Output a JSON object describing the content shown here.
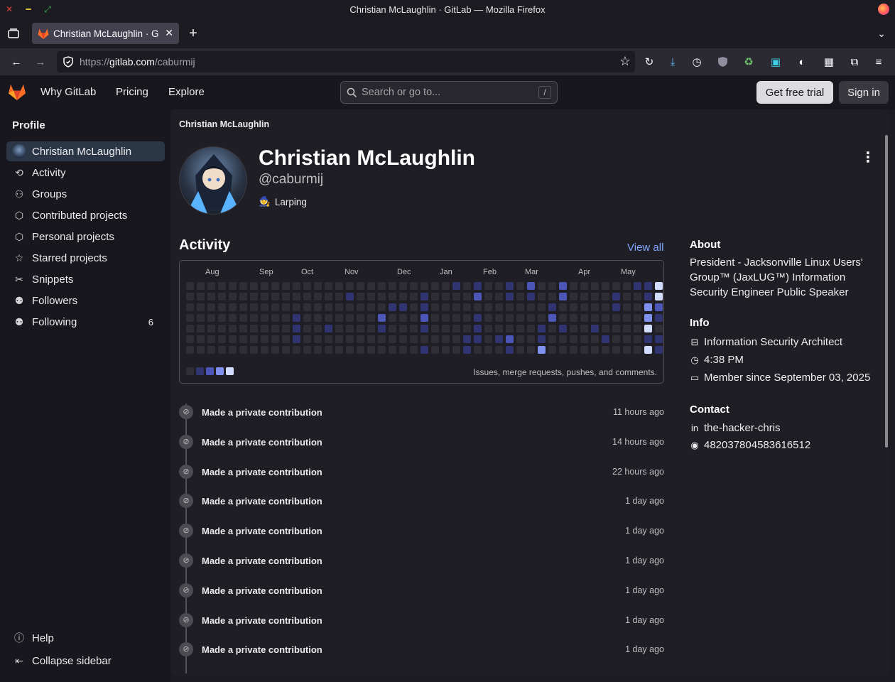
{
  "window": {
    "title": "Christian McLaughlin · GitLab — Mozilla Firefox"
  },
  "tab": {
    "title": "Christian McLaughlin · G"
  },
  "url": {
    "scheme": "https://",
    "host": "gitlab.com",
    "path": "/caburmij"
  },
  "header": {
    "nav": [
      "Why GitLab",
      "Pricing",
      "Explore"
    ],
    "search_placeholder": "Search or go to...",
    "search_shortcut": "/",
    "trial_label": "Get free trial",
    "signin_label": "Sign in"
  },
  "sidebar": {
    "section": "Profile",
    "items": [
      {
        "label": "Christian McLaughlin",
        "icon": "avatar"
      },
      {
        "label": "Activity",
        "icon": "history-icon"
      },
      {
        "label": "Groups",
        "icon": "group-icon"
      },
      {
        "label": "Contributed projects",
        "icon": "project-icon"
      },
      {
        "label": "Personal projects",
        "icon": "project-icon"
      },
      {
        "label": "Starred projects",
        "icon": "star-icon"
      },
      {
        "label": "Snippets",
        "icon": "snippet-icon"
      },
      {
        "label": "Followers",
        "icon": "users-icon"
      },
      {
        "label": "Following",
        "icon": "users-icon",
        "count": "6"
      }
    ],
    "help_label": "Help",
    "collapse_label": "Collapse sidebar"
  },
  "profile": {
    "breadcrumb": "Christian McLaughlin",
    "name": "Christian McLaughlin",
    "handle": "@caburmij",
    "status_emoji": "🧙",
    "status": "Larping"
  },
  "activity": {
    "heading": "Activity",
    "view_all": "View all",
    "months": [
      "Aug",
      "Sep",
      "Oct",
      "Nov",
      "Dec",
      "Jan",
      "Feb",
      "Mar",
      "Apr",
      "May"
    ],
    "note": "Issues, merge requests, pushes, and comments.",
    "colors": [
      "#2f2e35",
      "#303470",
      "#4c56b8",
      "#7f90ee",
      "#d2dcff"
    ],
    "events": [
      {
        "text": "Made a private contribution",
        "time": "11 hours ago"
      },
      {
        "text": "Made a private contribution",
        "time": "14 hours ago"
      },
      {
        "text": "Made a private contribution",
        "time": "22 hours ago"
      },
      {
        "text": "Made a private contribution",
        "time": "1 day ago"
      },
      {
        "text": "Made a private contribution",
        "time": "1 day ago"
      },
      {
        "text": "Made a private contribution",
        "time": "1 day ago"
      },
      {
        "text": "Made a private contribution",
        "time": "1 day ago"
      },
      {
        "text": "Made a private contribution",
        "time": "1 day ago"
      },
      {
        "text": "Made a private contribution",
        "time": "1 day ago"
      }
    ]
  },
  "about": {
    "heading": "About",
    "bio": "President - Jacksonville Linux Users' Group™ (JaxLUG™) Information Security Engineer Public Speaker",
    "info_heading": "Info",
    "job": "Information Security Architect",
    "local_time": "4:38 PM",
    "member_since": "Member since September 03, 2025",
    "contact_heading": "Contact",
    "linkedin": "the-hacker-chris",
    "discord": "482037804583616512"
  }
}
